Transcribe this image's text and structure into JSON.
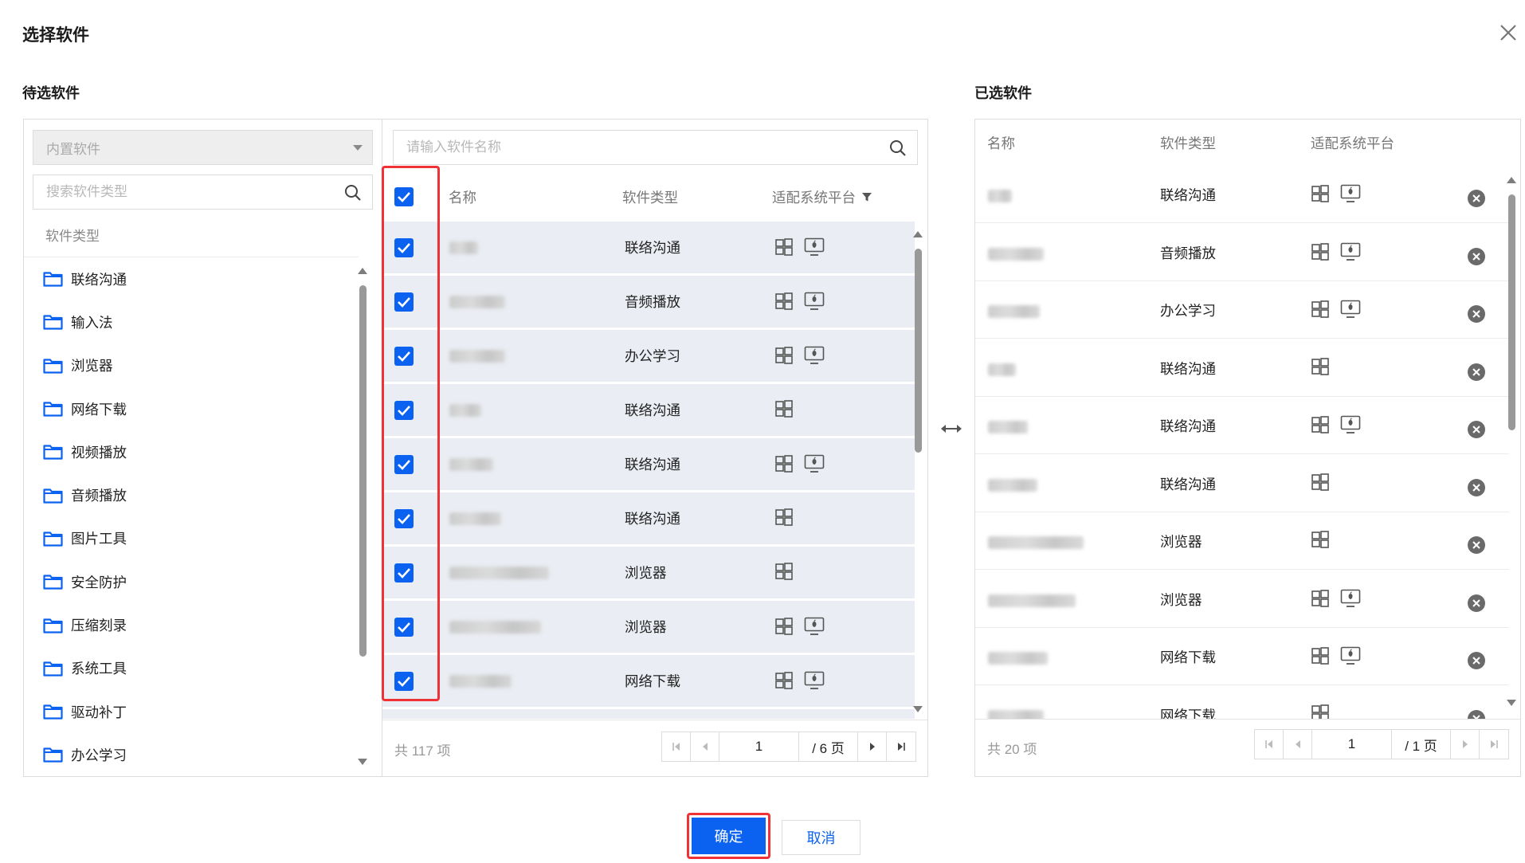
{
  "dialog": {
    "title": "选择软件"
  },
  "candidate": {
    "title": "待选软件",
    "category_select": {
      "value": "内置软件"
    },
    "category_search": {
      "placeholder": "搜索软件类型"
    },
    "category_header": "软件类型",
    "categories": [
      "联络沟通",
      "输入法",
      "浏览器",
      "网络下载",
      "视频播放",
      "音频播放",
      "图片工具",
      "安全防护",
      "压缩刻录",
      "系统工具",
      "驱动补丁",
      "办公学习"
    ],
    "software_search": {
      "placeholder": "请输入软件名称"
    },
    "columns": {
      "name": "名称",
      "type": "软件类型",
      "platform": "适配系统平台"
    },
    "rows": [
      {
        "type": "联络沟通",
        "platforms": [
          "windows",
          "mac"
        ],
        "checked": true
      },
      {
        "type": "音频播放",
        "platforms": [
          "windows",
          "mac"
        ],
        "checked": true
      },
      {
        "type": "办公学习",
        "platforms": [
          "windows",
          "mac"
        ],
        "checked": true
      },
      {
        "type": "联络沟通",
        "platforms": [
          "windows"
        ],
        "checked": true
      },
      {
        "type": "联络沟通",
        "platforms": [
          "windows",
          "mac"
        ],
        "checked": true
      },
      {
        "type": "联络沟通",
        "platforms": [
          "windows"
        ],
        "checked": true
      },
      {
        "type": "浏览器",
        "platforms": [
          "windows"
        ],
        "checked": true
      },
      {
        "type": "浏览器",
        "platforms": [
          "windows",
          "mac"
        ],
        "checked": true
      },
      {
        "type": "网络下载",
        "platforms": [
          "windows",
          "mac"
        ],
        "checked": true
      }
    ],
    "total": "共 117 项",
    "pager": {
      "page": "1",
      "total_pages": "/ 6 页"
    }
  },
  "selected": {
    "title": "已选软件",
    "columns": {
      "name": "名称",
      "type": "软件类型",
      "platform": "适配系统平台"
    },
    "rows": [
      {
        "type": "联络沟通",
        "platforms": [
          "windows",
          "mac"
        ]
      },
      {
        "type": "音频播放",
        "platforms": [
          "windows",
          "mac"
        ]
      },
      {
        "type": "办公学习",
        "platforms": [
          "windows",
          "mac"
        ]
      },
      {
        "type": "联络沟通",
        "platforms": [
          "windows"
        ]
      },
      {
        "type": "联络沟通",
        "platforms": [
          "windows",
          "mac"
        ]
      },
      {
        "type": "联络沟通",
        "platforms": [
          "windows"
        ]
      },
      {
        "type": "浏览器",
        "platforms": [
          "windows"
        ]
      },
      {
        "type": "浏览器",
        "platforms": [
          "windows",
          "mac"
        ]
      },
      {
        "type": "网络下载",
        "platforms": [
          "windows",
          "mac"
        ]
      },
      {
        "type": "网络下载",
        "platforms": [
          "windows"
        ]
      }
    ],
    "total": "共 20 项",
    "pager": {
      "page": "1",
      "total_pages": "/ 1 页"
    }
  },
  "footer": {
    "ok_label": "确定",
    "cancel_label": "取消"
  },
  "colors": {
    "primary": "#0b62f0",
    "highlight": "#f03236",
    "row_bg": "#eaedf3"
  }
}
